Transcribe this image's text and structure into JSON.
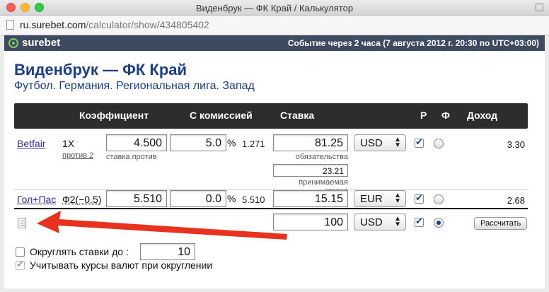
{
  "window": {
    "title": "Виденбрук — ФК Край / Калькулятор"
  },
  "url": {
    "host": "ru.surebet.com",
    "path": "/calculator/show/434805402"
  },
  "brand": {
    "name": "surebet",
    "event_info": "Событие через 2 часа (7 августа 2012 г. 20:30 по UTC+03:00)"
  },
  "match": {
    "title": "Виденбрук — ФК Край",
    "league": "Футбол. Германия. Региональная лига. Запад"
  },
  "columns": {
    "coef": "Коэффициент",
    "commission": "С комиссией",
    "stake": "Ставка",
    "p": "Р",
    "f": "Ф",
    "income": "Доход"
  },
  "rows": [
    {
      "bookmaker": "Betfair",
      "outcome": "1X",
      "outcome_sub": "против 2",
      "coef": "4.500",
      "coef_sub": "ставка против",
      "commission": "5.0",
      "commission_unit": "%",
      "commission_result": "1.271",
      "stake": "81.25",
      "stake_sub": "обязательства",
      "accepted": "23.21",
      "accepted_sub": "принимаемая ставка",
      "currency": "USD",
      "income": "3.30"
    },
    {
      "bookmaker": "Гол+Пас",
      "outcome": "Ф2(−0.5)",
      "coef": "5.510",
      "commission": "0.0",
      "commission_unit": "%",
      "commission_result": "5.510",
      "stake": "15.15",
      "currency": "EUR",
      "income": "2.68"
    }
  ],
  "total": {
    "stake": "100",
    "currency": "USD",
    "calc_label": "Рассчитать"
  },
  "options": {
    "round_label": "Округлять ставки до :",
    "round_value": "10",
    "rates_label": "Учитывать курсы валют при округлении"
  },
  "colors": {
    "accent": "#1a3e8a",
    "annotation_arrow": "#e8321e",
    "brand_bar": "#3c4b5f"
  }
}
